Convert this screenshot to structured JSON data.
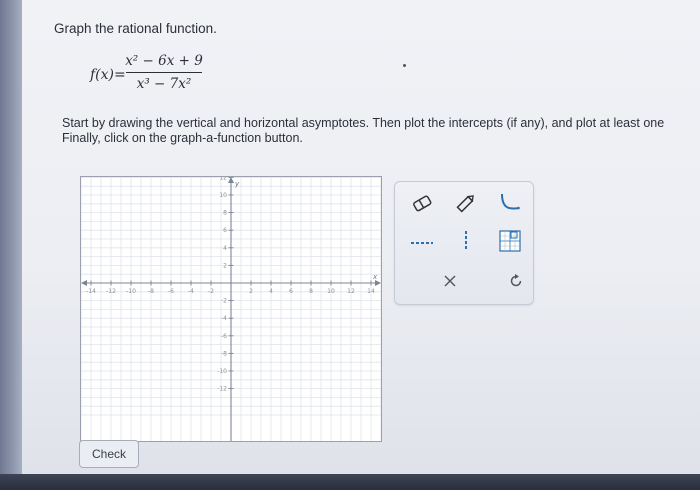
{
  "question": {
    "title": "Graph the rational function.",
    "function_lhs": "f(x)=",
    "numerator": "x² − 6x + 9",
    "denominator": "x³ − 7x²",
    "instructions_line1": "Start by drawing the vertical and horizontal asymptotes. Then plot the intercepts (if any), and plot at least one",
    "instructions_line2": "Finally, click on the graph-a-function button."
  },
  "graph": {
    "x_axis_label": "x",
    "y_axis_label": "y",
    "x_range": [
      -15,
      15
    ],
    "y_range": [
      -15,
      15
    ],
    "grid": true,
    "x_tick_labels": [
      "-14",
      "-12",
      "-10",
      "-8",
      "-6",
      "-4",
      "-2",
      "2",
      "4",
      "6",
      "8",
      "10",
      "12",
      "14"
    ],
    "y_tick_labels": [
      "14",
      "12",
      "10",
      "8",
      "6",
      "4",
      "2",
      "-2",
      "-4",
      "-6",
      "-8",
      "-10",
      "-12"
    ]
  },
  "toolbox": {
    "tools": [
      "eraser-icon",
      "pencil-icon",
      "graph-a-function-icon",
      "horizontal-asymptote-icon",
      "vertical-asymptote-icon",
      "grid-point-icon",
      "clear-icon",
      "undo-icon"
    ],
    "accent_color": "#2a6fb0"
  },
  "check_button": {
    "label": "Check"
  }
}
